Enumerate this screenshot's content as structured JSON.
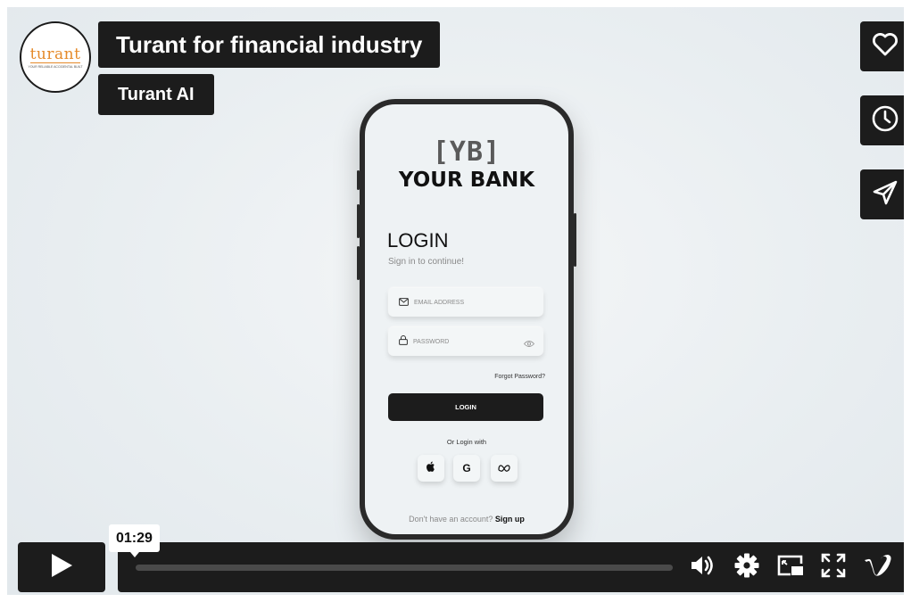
{
  "video": {
    "title": "Turant for financial industry",
    "author": "Turant AI",
    "channel_logo_text": "turant",
    "channel_logo_tagline": "YOUR RELIABLE ACCIDENTAL BUILT",
    "timestamp": "01:29",
    "progress_fraction": 0.0
  },
  "side_actions": [
    {
      "icon": "heart-icon"
    },
    {
      "icon": "clock-icon"
    },
    {
      "icon": "send-icon"
    }
  ],
  "controls": {
    "play_icon": "play-icon",
    "icons": [
      "volume-icon",
      "settings-icon",
      "pip-icon",
      "fullscreen-icon",
      "vimeo-icon"
    ]
  },
  "phone_screen": {
    "logo_mark": "[YB]",
    "bank_name": "YOUR BANK",
    "login_title": "LOGIN",
    "login_subtitle": "Sign in to continue!",
    "email_placeholder": "EMAIL ADDRESS",
    "password_placeholder": "PASSWORD",
    "forgot_password": "Forgot Password?",
    "login_button": "LOGIN",
    "or_login_with": "Or Login with",
    "no_account_text": "Don't have an account?",
    "signup_text": "Sign up"
  },
  "colors": {
    "overlay_dark": "#1c1c1c",
    "logo_orange": "#e58a2a",
    "background": "#e8edf0"
  }
}
